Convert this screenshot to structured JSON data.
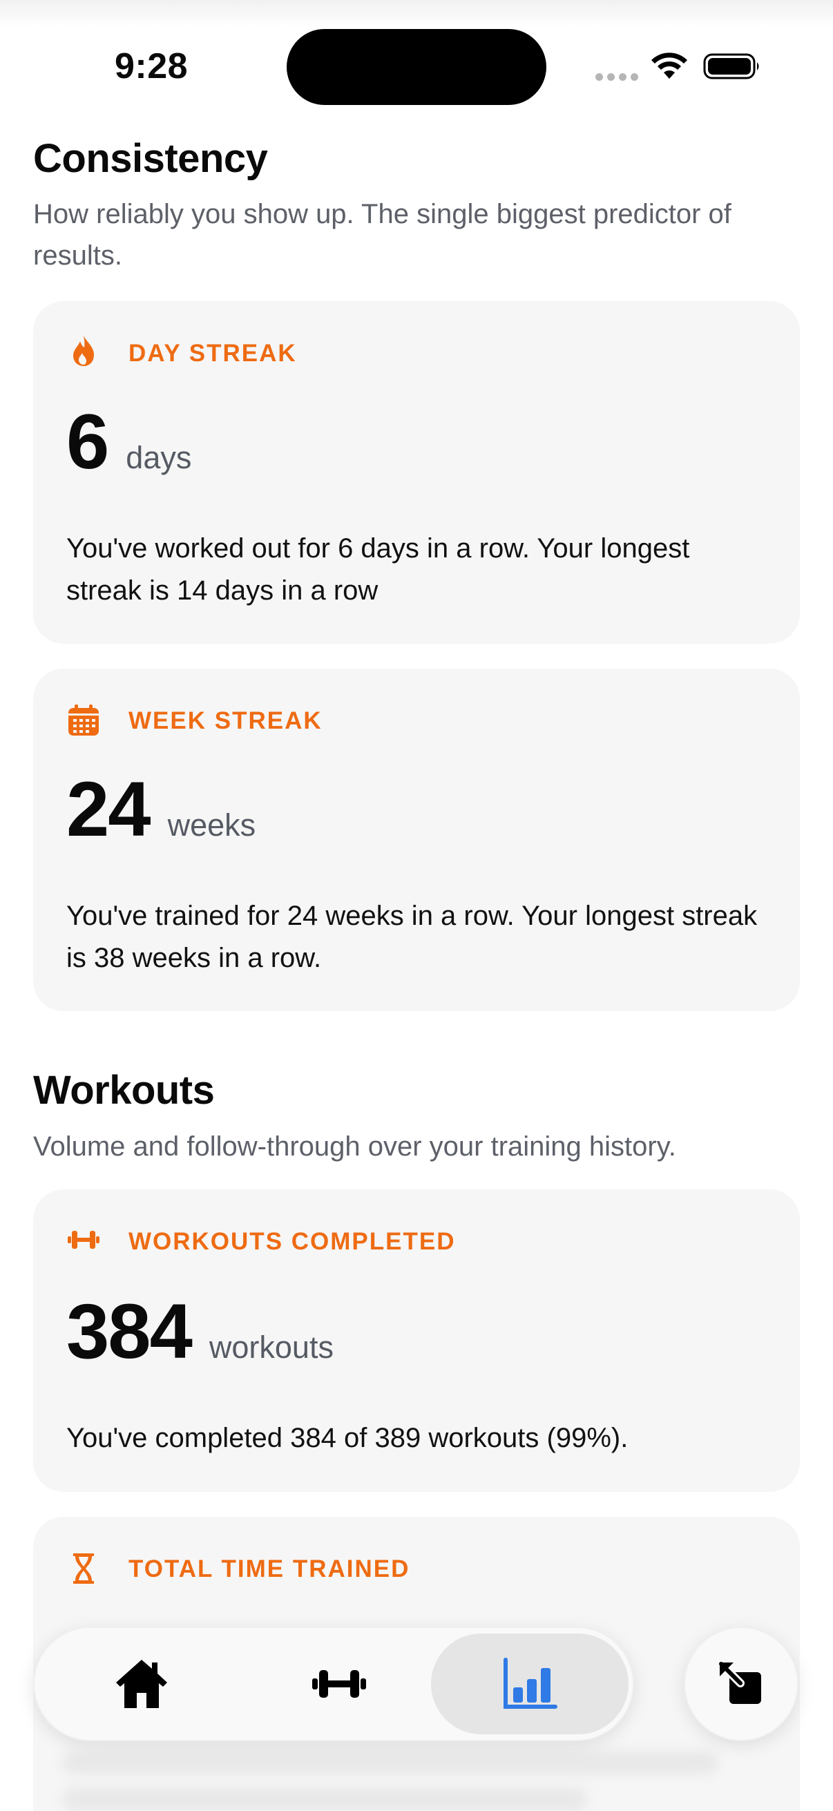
{
  "status_bar": {
    "time": "9:28"
  },
  "sections": {
    "consistency": {
      "title": "Consistency",
      "subtitle": "How reliably you show up. The single biggest predictor of results."
    },
    "workouts": {
      "title": "Workouts",
      "subtitle": "Volume and follow-through over your training history."
    }
  },
  "cards": {
    "day_streak": {
      "label": "DAY STREAK",
      "icon": "flame-icon",
      "value": "6",
      "unit": "days",
      "description": "You've worked out for 6 days in a row. Your longest streak is 14 days in a row"
    },
    "week_streak": {
      "label": "WEEK STREAK",
      "icon": "calendar-icon",
      "value": "24",
      "unit": "weeks",
      "description": "You've trained for 24 weeks in a row. Your longest streak is 38 weeks in a row."
    },
    "workouts_completed": {
      "label": "WORKOUTS COMPLETED",
      "icon": "dumbbell-icon",
      "value": "384",
      "unit": "workouts",
      "description": "You've completed 384 of 389 workouts (99%)."
    },
    "total_time": {
      "label": "TOTAL TIME TRAINED",
      "icon": "hourglass-icon"
    }
  },
  "tab_bar": {
    "tabs": [
      {
        "icon": "home-icon",
        "active": false
      },
      {
        "icon": "dumbbell-icon",
        "active": false
      },
      {
        "icon": "bar-chart-icon",
        "active": true
      }
    ],
    "fab_icon": "expand-arrow-icon"
  },
  "colors": {
    "accent": "#ee6b12",
    "active_tab": "#2f7ae5",
    "card_bg": "#f6f6f6",
    "subtitle": "#5d6068"
  }
}
